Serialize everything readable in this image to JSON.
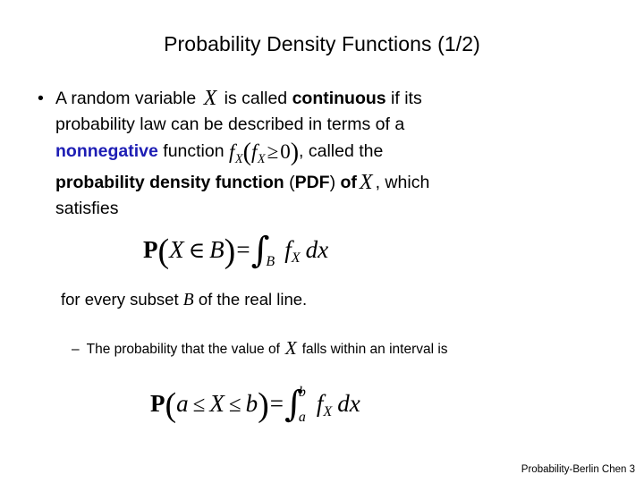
{
  "slide": {
    "title": "Probability Density Functions (1/2)",
    "footer": "Probability-Berlin Chen 3",
    "accent_blue": "#1d1db4",
    "background": "#ffffff"
  },
  "bullet": {
    "marker": "•",
    "line1_part1": "A random variable ",
    "line1_var": "X",
    "line1_part2": " is called ",
    "line1_bold": "continuous",
    "line1_part3": " if its",
    "line2": "probability law can be described in terms of a",
    "line3_blue": "nonnegative",
    "line3_part1": " function ",
    "line3_math": {
      "f": "f",
      "f_sub": "X",
      "open": "(",
      "f2": "f",
      "f2_sub": "X",
      "relation": "≥",
      "zero": "0",
      "close": ")"
    },
    "line3_part2": ", called the",
    "line4_bold": "probability density function",
    "line4_part1": " (",
    "line4_bold2": "PDF",
    "line4_part2": ") ",
    "line4_bold3": "of",
    "line4_var": "X",
    "line4_part3": ", which",
    "line5": "satisfies"
  },
  "equation_pdf": {
    "P": "P",
    "open_paren": "(",
    "variable": "X",
    "relation": "∈",
    "set": "B",
    "close_paren": ")",
    "equals": "=",
    "integral": "∫",
    "integral_sub": "B",
    "integrand_f": "f",
    "integrand_sub": "X",
    "differential": "dx"
  },
  "after_equation": {
    "part1": "for every subset ",
    "set_var": "B",
    "part2": " of the real line."
  },
  "sub_bullet": {
    "marker": "–",
    "part1": "The probability that the value  of",
    "variable": "X",
    "part2": "falls within an interval is"
  },
  "equation_interval": {
    "P": "P",
    "open_paren": "(",
    "lower": "a",
    "rel1": "≤",
    "variable": "X",
    "rel2": "≤",
    "upper": "b",
    "close_paren": ")",
    "equals": "=",
    "integral": "∫",
    "limit_upper": "b",
    "limit_lower": "a",
    "integrand_f": "f",
    "integrand_sub": "X",
    "differential": "dx"
  }
}
